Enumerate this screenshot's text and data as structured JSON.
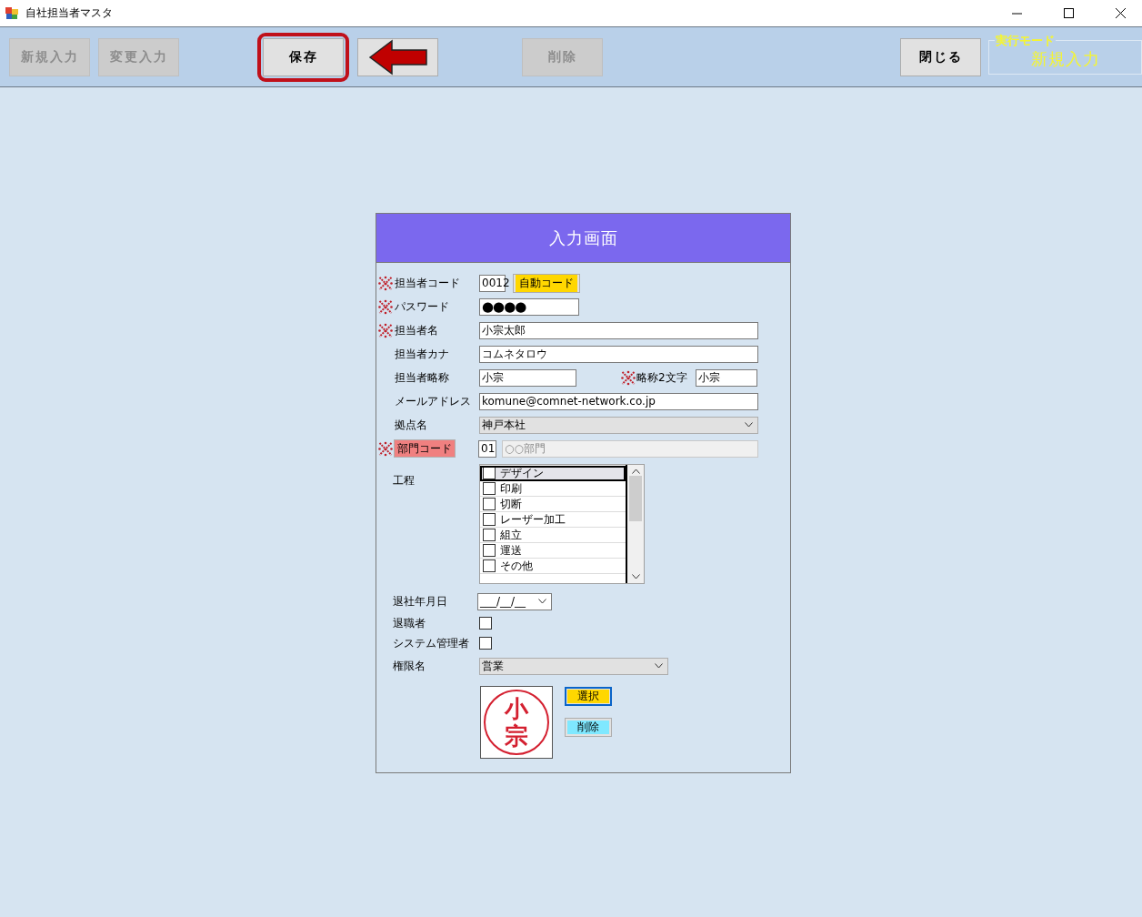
{
  "window": {
    "title": "自社担当者マスタ"
  },
  "toolbar": {
    "groups": [
      [
        {
          "kind": "text",
          "label": "新規入力",
          "disabled": true,
          "highlighted": false
        },
        {
          "kind": "text",
          "label": "変更入力",
          "disabled": true,
          "highlighted": false
        }
      ],
      [
        {
          "kind": "text",
          "label": "保存",
          "disabled": false,
          "highlighted": true
        },
        {
          "kind": "arrow",
          "disabled": false,
          "highlighted": false
        }
      ],
      [
        {
          "kind": "text",
          "label": "削除",
          "disabled": true,
          "highlighted": false
        }
      ],
      [
        {
          "kind": "text",
          "label": "閉じる",
          "disabled": false,
          "highlighted": false
        }
      ]
    ],
    "mode": {
      "legend": "実行モード",
      "value": "新規入力"
    }
  },
  "form": {
    "title": "入力画面",
    "rows": [
      {
        "kind": "code",
        "label": "担当者コード",
        "required": true,
        "value": "0012",
        "button": "自動コード"
      },
      {
        "kind": "short",
        "label": "パスワード",
        "required": true,
        "value": "●●●●"
      },
      {
        "kind": "text",
        "label": "担当者名",
        "required": true,
        "value": "小宗太郎"
      },
      {
        "kind": "text",
        "label": "担当者カナ",
        "required": false,
        "value": "コムネタロウ"
      },
      {
        "kind": "pair",
        "label": "担当者略称",
        "required": false,
        "value": "小宗",
        "second_label": "略称2文字",
        "second_required": true,
        "second_value": "小宗"
      },
      {
        "kind": "text",
        "label": "メールアドレス",
        "required": false,
        "value": "komune@comnet-network.co.jp"
      },
      {
        "kind": "select",
        "label": "拠点名",
        "required": false,
        "value": "神戸本社"
      },
      {
        "kind": "dept",
        "label": "部門コード",
        "required": true,
        "value": "01",
        "name": "○○部門"
      },
      {
        "kind": "checklist",
        "label": "工程",
        "required": false,
        "items": [
          {
            "label": "デザイン",
            "checked": false,
            "selected": true
          },
          {
            "label": "印刷",
            "checked": false,
            "selected": false
          },
          {
            "label": "切断",
            "checked": false,
            "selected": false
          },
          {
            "label": "レーザー加工",
            "checked": false,
            "selected": false
          },
          {
            "label": "組立",
            "checked": false,
            "selected": false
          },
          {
            "label": "運送",
            "checked": false,
            "selected": false
          },
          {
            "label": "その他",
            "checked": false,
            "selected": false
          }
        ]
      },
      {
        "kind": "date",
        "label": "退社年月日",
        "required": false,
        "value": "___/__/__"
      },
      {
        "kind": "checkbox",
        "label": "退職者",
        "required": false,
        "checked": false
      },
      {
        "kind": "checkbox",
        "label": "システム管理者",
        "required": false,
        "checked": false
      },
      {
        "kind": "role",
        "label": "権限名",
        "required": false,
        "value": "営業"
      },
      {
        "kind": "seal",
        "seal_text": [
          "小",
          "宗"
        ],
        "buttons": [
          {
            "label": "選択",
            "color": "#ffd700",
            "focused": true
          },
          {
            "label": "削除",
            "color": "#7fe8ff",
            "focused": false
          }
        ]
      }
    ]
  }
}
